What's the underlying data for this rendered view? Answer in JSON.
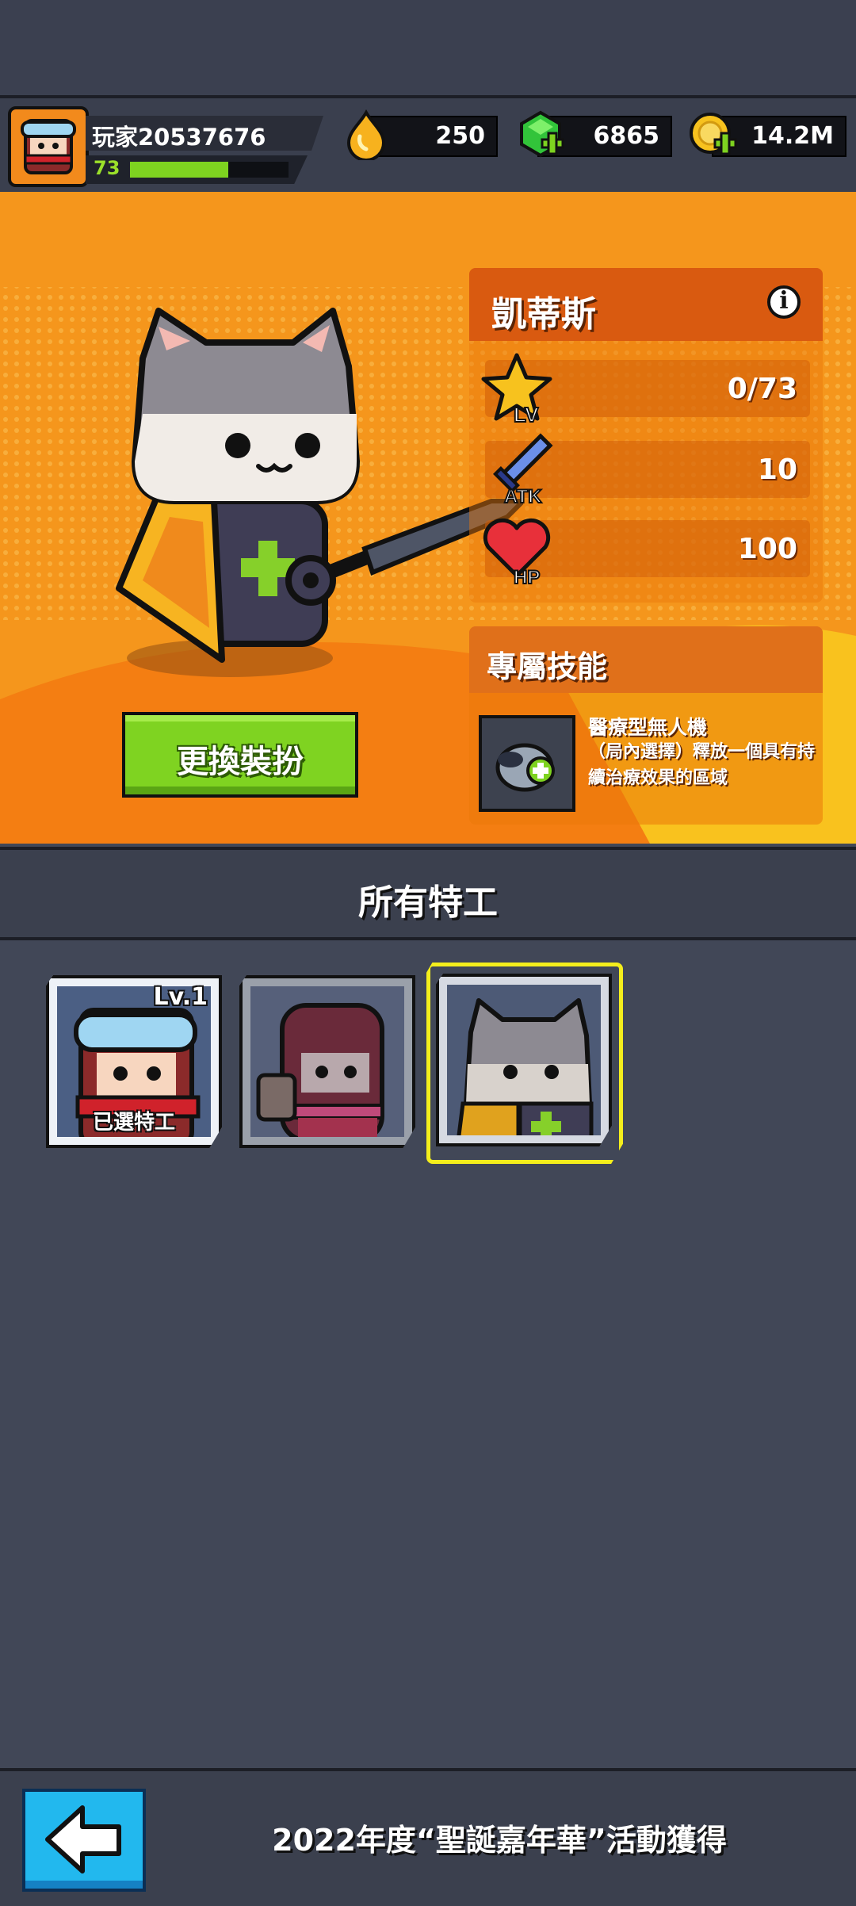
{
  "player": {
    "name": "玩家20537676",
    "level": "73",
    "xp_fraction": 0.62,
    "avatar_icon": "ninja-avatar-icon"
  },
  "resources": [
    {
      "icon": "energy-drop-icon",
      "value": "250"
    },
    {
      "icon": "green-gem-plus-icon",
      "value": "6865"
    },
    {
      "icon": "gold-coin-plus-icon",
      "value": "14.2M"
    }
  ],
  "hero": {
    "name": "凱蒂斯",
    "info_icon": "info-icon",
    "stats": [
      {
        "icon": "level-star-icon",
        "badge": "LV",
        "value": "0/73"
      },
      {
        "icon": "attack-sword-icon",
        "badge": "ATK",
        "value": "10"
      },
      {
        "icon": "hp-heart-icon",
        "badge": "HP",
        "value": "100"
      }
    ],
    "skill_section_title": "專屬技能",
    "skill": {
      "icon": "medic-drone-icon",
      "name": "醫療型無人機",
      "description": "（局內選擇）釋放一個具有持續治療效果的區域"
    },
    "change_outfit_label": "更換裝扮"
  },
  "agents_section": {
    "title": "所有特工",
    "cards": [
      {
        "name": "ninja-agent",
        "level": "Lv.1",
        "tag": "已選特工",
        "state": "selected-agent"
      },
      {
        "name": "red-hood-agent",
        "level": "",
        "tag": "",
        "state": "locked"
      },
      {
        "name": "cat-medic-agent",
        "level": "",
        "tag": "",
        "state": "viewing"
      }
    ]
  },
  "footer": {
    "back_icon": "arrow-left-icon",
    "obtain_text": "2022年度“聖誕嘉年華”活動獲得"
  },
  "colors": {
    "hero_bg": "#f6a21d",
    "panel_head": "#d95a10",
    "button_green": "#7fd321",
    "selection_yellow": "#f4ee1c",
    "back_blue": "#22b8ee",
    "page_bg": "#414757"
  }
}
